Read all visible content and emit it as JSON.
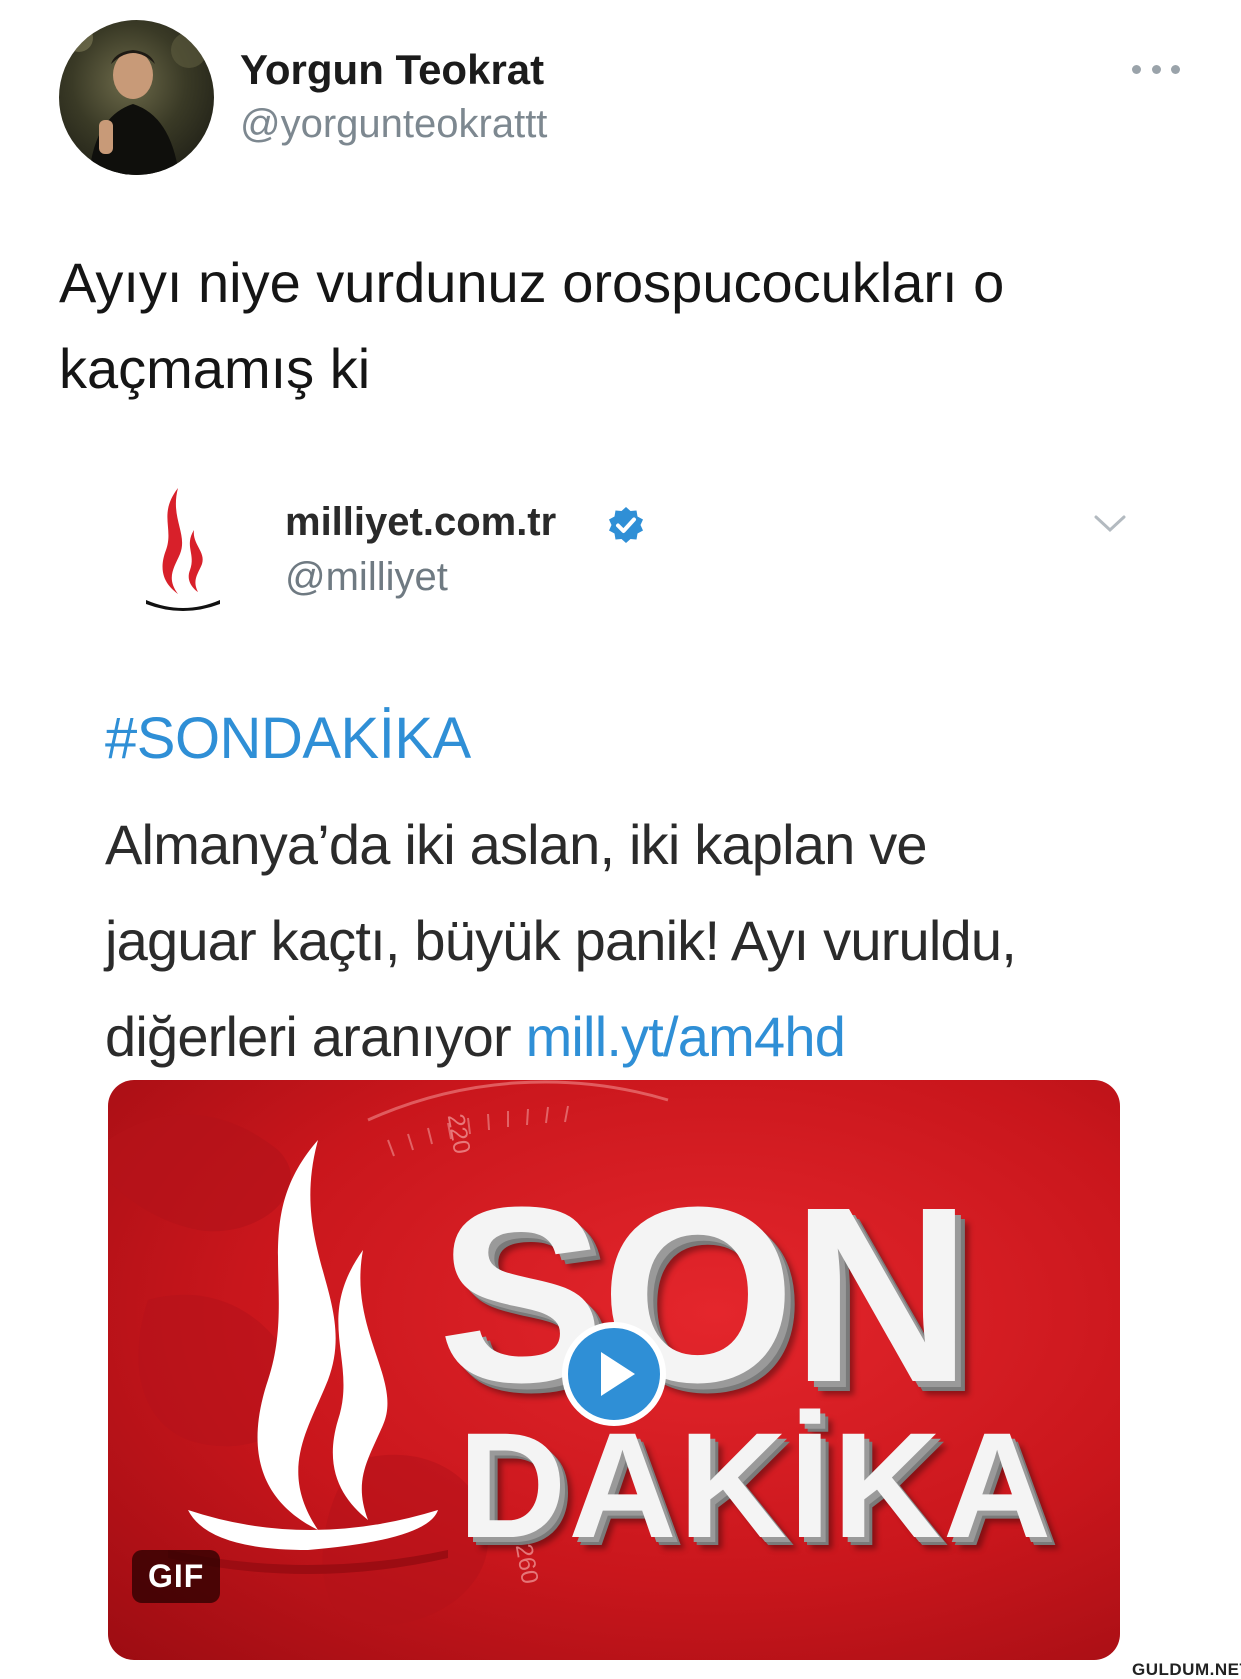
{
  "tweet": {
    "author": {
      "name": "Yorgun Teokrat",
      "handle": "@yorgunteokrattt"
    },
    "text_line1": "Ayıyı niye vurdunuz orospucocukları o",
    "text_line2": "kaçmamış ki",
    "more_icon": "more-horizontal-icon"
  },
  "quoted": {
    "name": "milliyet.com.tr",
    "handle": "@milliyet",
    "verified_icon": "verified-icon",
    "hashtag": "#SONDAKİKA",
    "body_line1": "Almanya’da iki aslan, iki kaplan ve",
    "body_line2": "jaguar kaçtı, büyük panik! Ayı vuruldu,",
    "body_line3_text": "diğerleri aranıyor ",
    "link": "mill.yt/am4hd",
    "media": {
      "headline_top": "SON",
      "headline_bottom": "DAKİKA",
      "dial_labels": [
        "220",
        "260"
      ],
      "badge": "GIF",
      "play_icon": "play-icon"
    }
  },
  "watermark": "GULDUM.NET",
  "colors": {
    "link_blue": "#2f8fd6",
    "brand_red": "#d8202a",
    "text_dark": "#151515",
    "text_gray": "#7d8890"
  }
}
